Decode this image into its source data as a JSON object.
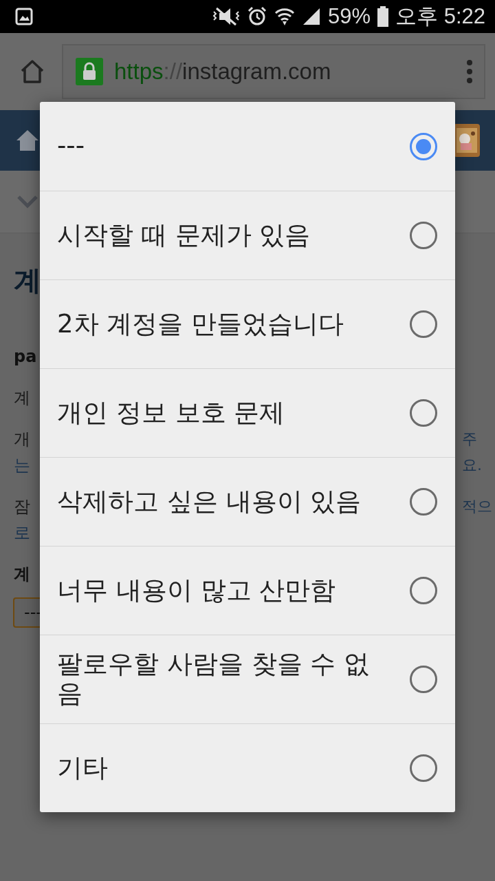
{
  "status_bar": {
    "battery": "59%",
    "time": "오후 5:22"
  },
  "browser": {
    "url_scheme": "https",
    "url_separator": "://",
    "url_host": "instagram.com"
  },
  "page_lines": [
    {
      "left": {
        "text": "계",
        "kind": "heading"
      }
    },
    {
      "left": {
        "text": "pa",
        "kind": "bold"
      }
    },
    {
      "left": {
        "text": "계",
        "kind": "text"
      }
    },
    {
      "left": {
        "text": "개",
        "kind": "text"
      },
      "right": {
        "text": "주",
        "kind": "link"
      }
    },
    {
      "left": {
        "text": "는",
        "kind": "link"
      },
      "right": {
        "text": "요.",
        "kind": "link"
      }
    },
    {
      "left": {
        "text": "잠",
        "kind": "text"
      },
      "right": {
        "text": "적으",
        "kind": "link"
      }
    },
    {
      "left": {
        "text": "로",
        "kind": "link"
      }
    },
    {
      "left": {
        "text": "계",
        "kind": "bold"
      }
    },
    {
      "left": {
        "text": "---",
        "kind": "select"
      }
    }
  ],
  "dialog": {
    "options": [
      {
        "label": "---",
        "selected": true
      },
      {
        "label": "시작할 때 문제가 있음",
        "selected": false
      },
      {
        "label": "2차 계정을 만들었습니다",
        "selected": false
      },
      {
        "label": "개인 정보 보호 문제",
        "selected": false
      },
      {
        "label": "삭제하고 싶은 내용이 있음",
        "selected": false
      },
      {
        "label": "너무 내용이 많고 산만함",
        "selected": false
      },
      {
        "label": "팔로우할 사람을 찾을 수 없음",
        "selected": false
      },
      {
        "label": "기타",
        "selected": false
      }
    ]
  }
}
